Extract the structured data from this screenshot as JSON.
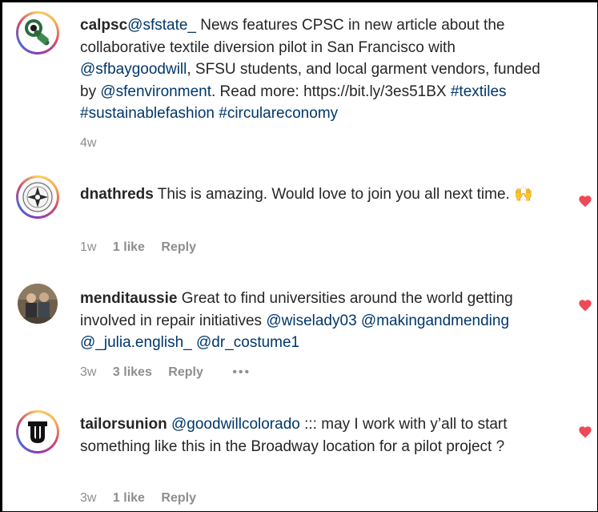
{
  "comments": [
    {
      "username": "calpsc",
      "parts": [
        {
          "t": "mention",
          "v": "@sfstate_"
        },
        {
          "t": "text",
          "v": " News features CPSC in new article about the collaborative textile diversion pilot in San Francisco with "
        },
        {
          "t": "mention",
          "v": "@sfbaygoodwill"
        },
        {
          "t": "text",
          "v": ", SFSU students, and local garment vendors, funded by "
        },
        {
          "t": "mention",
          "v": "@sfenvironment"
        },
        {
          "t": "text",
          "v": ". Read more: https://bit.ly/3es51BX "
        },
        {
          "t": "tag",
          "v": "#textiles"
        },
        {
          "t": "text",
          "v": " "
        },
        {
          "t": "tag",
          "v": "#sustainablefashion"
        },
        {
          "t": "text",
          "v": " "
        },
        {
          "t": "tag",
          "v": "#circulareconomy"
        }
      ],
      "time": "4w",
      "likes": "",
      "reply": "",
      "more": "",
      "liked": false
    },
    {
      "username": "dnathreds",
      "parts": [
        {
          "t": "text",
          "v": " This is amazing. Would love to join you all next time. 🙌"
        }
      ],
      "time": "1w",
      "likes": "1 like",
      "reply": "Reply",
      "more": "",
      "liked": true
    },
    {
      "username": "menditaussie",
      "parts": [
        {
          "t": "text",
          "v": " Great to find universities around the world getting involved in repair initiatives "
        },
        {
          "t": "mention",
          "v": "@wiselady03"
        },
        {
          "t": "text",
          "v": " "
        },
        {
          "t": "mention",
          "v": "@makingandmending"
        },
        {
          "t": "text",
          "v": " "
        },
        {
          "t": "mention",
          "v": "@_julia.english_"
        },
        {
          "t": "text",
          "v": " "
        },
        {
          "t": "mention",
          "v": "@dr_costume1"
        }
      ],
      "time": "3w",
      "likes": "3 likes",
      "reply": "Reply",
      "more": "•••",
      "liked": true
    },
    {
      "username": "tailorsunion",
      "parts": [
        {
          "t": "text",
          "v": " "
        },
        {
          "t": "mention",
          "v": "@goodwillcolorado"
        },
        {
          "t": "text",
          "v": " ::: may I work with y’all to start something like this in the Broadway location for a pilot project ?"
        }
      ],
      "time": "3w",
      "likes": "1 like",
      "reply": "Reply",
      "more": "",
      "liked": true
    }
  ],
  "colors": {
    "mention": "#00376b",
    "heart": "#ed4956",
    "meta": "#8e8e8e"
  }
}
